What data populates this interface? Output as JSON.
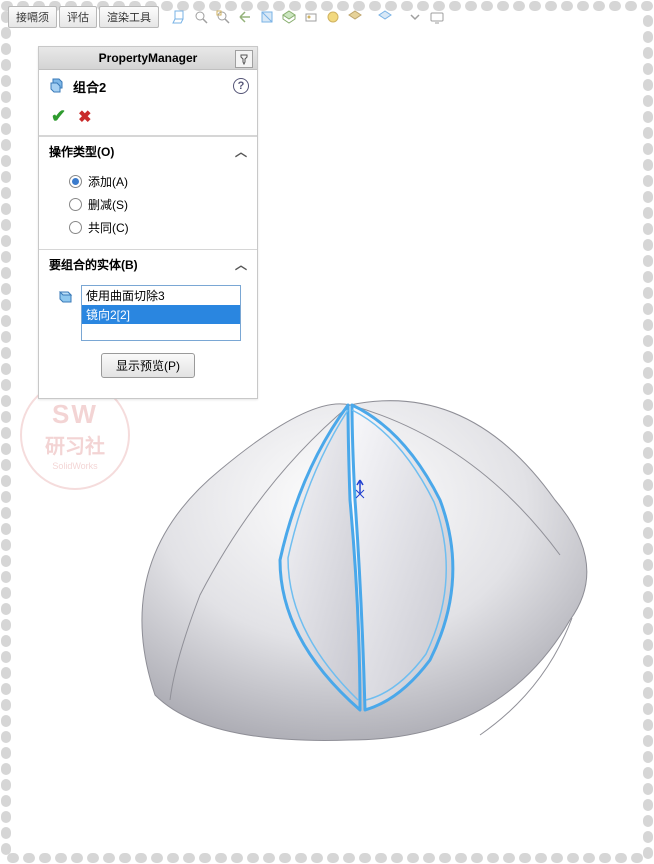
{
  "toolbar": {
    "tab1": "接嗝须",
    "tab2": "评估",
    "tab3": "渲染工具"
  },
  "pm": {
    "header": "PropertyManager",
    "feature_name": "组合2",
    "help": "?",
    "section_op_title": "操作类型(O)",
    "op_add": "添加(A)",
    "op_sub": "删减(S)",
    "op_common": "共同(C)",
    "section_body_title": "要组合的实体(B)",
    "body1": "使用曲面切除3",
    "body2": "镜向2[2]",
    "preview_btn": "显示预览(P)"
  },
  "watermark": {
    "l1": "SW",
    "l2": "研习社",
    "l3": "SolidWorks"
  }
}
